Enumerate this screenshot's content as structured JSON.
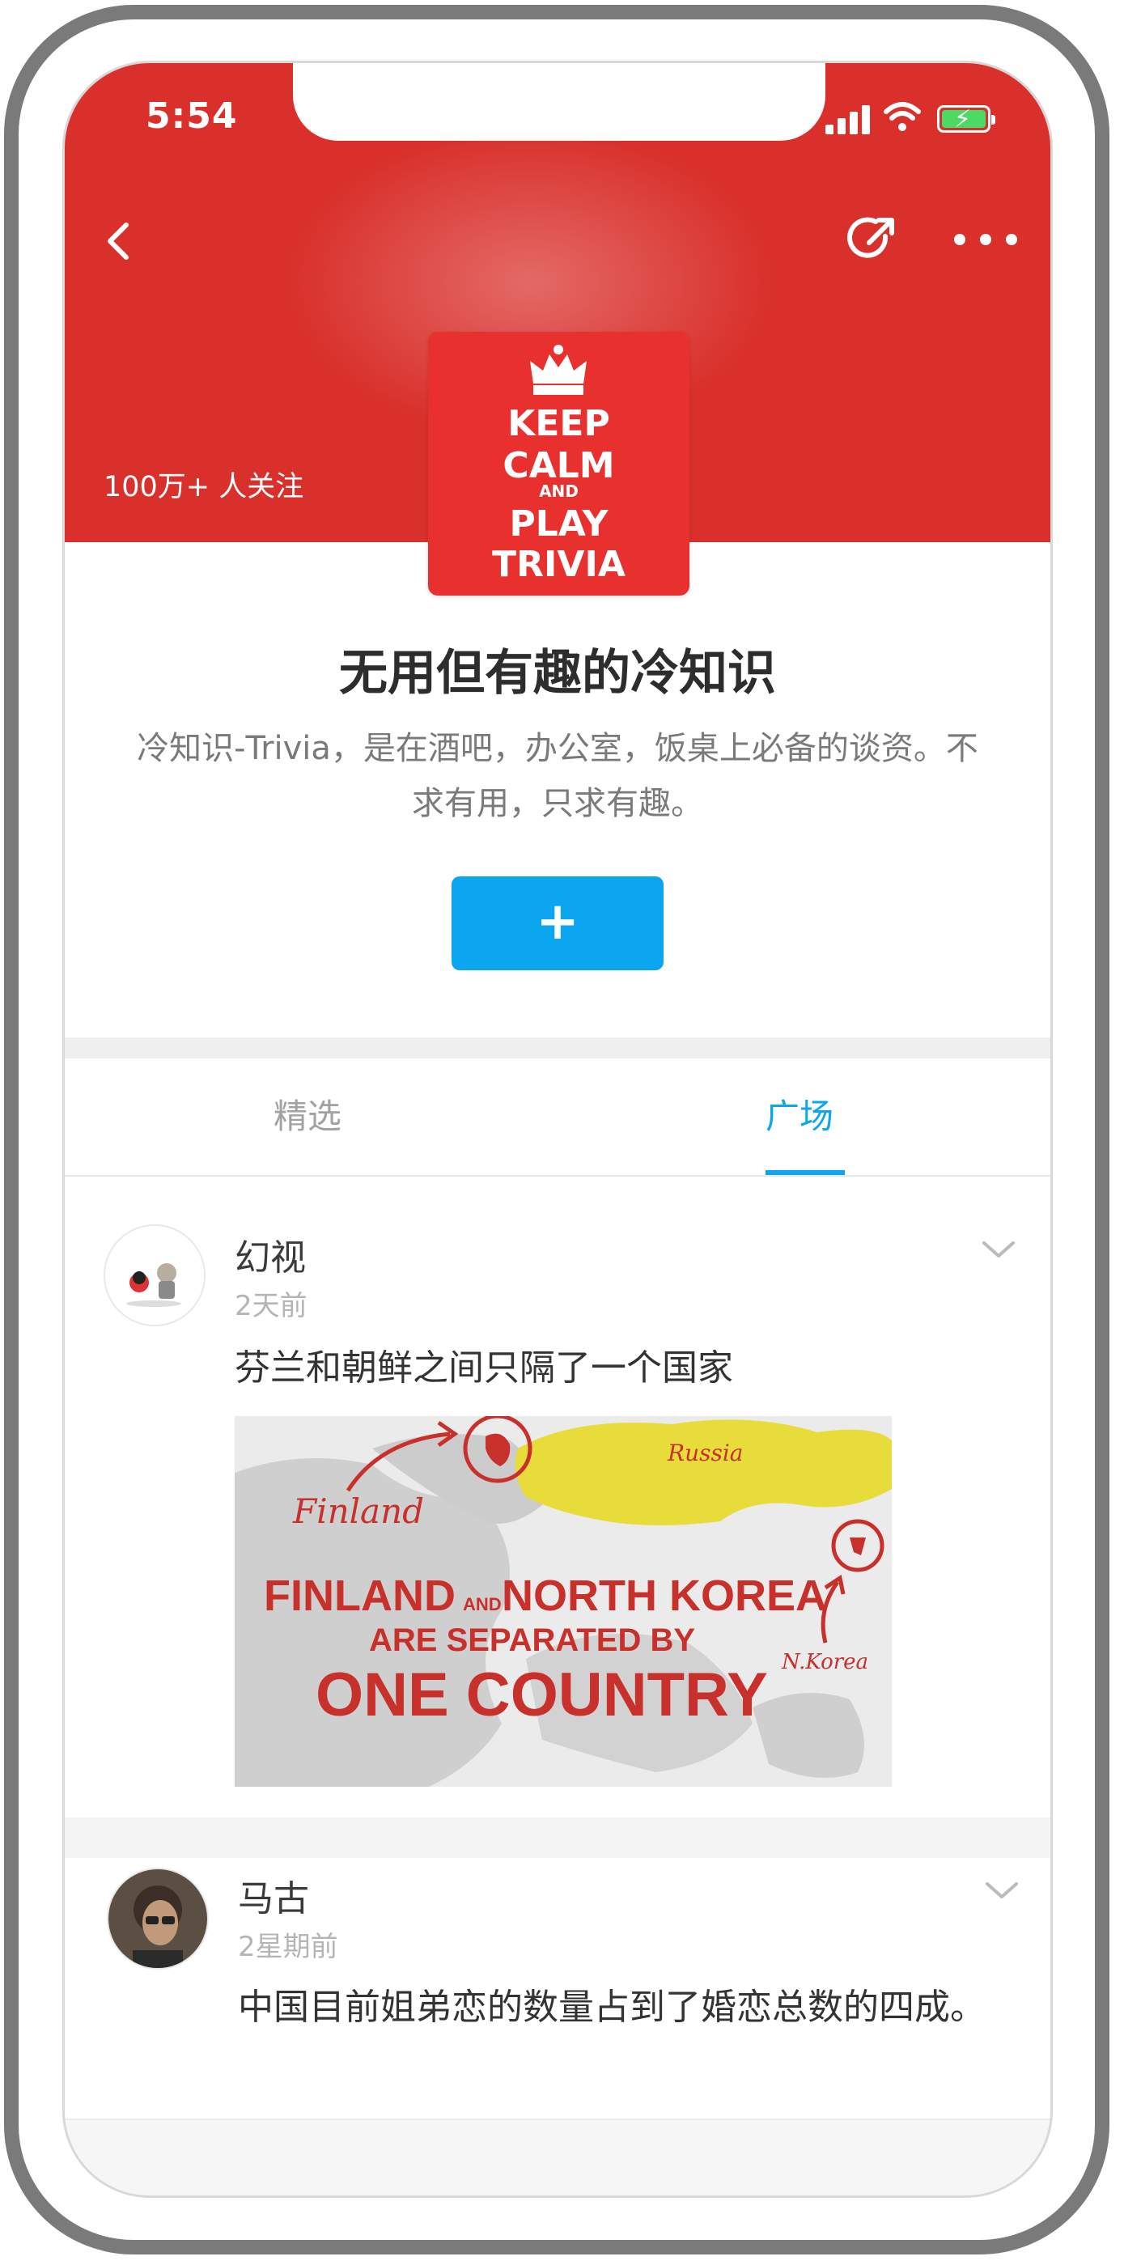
{
  "status_bar": {
    "time": "5:54"
  },
  "header": {
    "followers": "100万+ 人关注",
    "cover_lines": [
      "KEEP",
      "CALM",
      "AND",
      "PLAY",
      "TRIVIA"
    ]
  },
  "topic": {
    "title": "无用但有趣的冷知识",
    "description": "冷知识-Trivia，是在酒吧，办公室，饭桌上必备的谈资。不求有用，只求有趣。",
    "follow_button": "+"
  },
  "tabs": [
    {
      "label": "精选",
      "active": false
    },
    {
      "label": "广场",
      "active": true
    }
  ],
  "posts": [
    {
      "author": "幻视",
      "time": "2天前",
      "text": "芬兰和朝鲜之间只隔了一个国家",
      "image": {
        "labels": {
          "finland": "Finland",
          "russia": "Russia",
          "nkorea": "N.Korea",
          "headline1": "FINLAND",
          "and": "AND",
          "headline2": "NORTH KOREA",
          "headline3": "ARE SEPARATED BY",
          "headline4": "ONE COUNTRY"
        }
      }
    },
    {
      "author": "马古",
      "time": "2星期前",
      "text": "中国目前姐弟恋的数量占到了婚恋总数的四成。"
    }
  ],
  "colors": {
    "header_red": "#d9302b",
    "accent_blue": "#0ba6ef"
  }
}
